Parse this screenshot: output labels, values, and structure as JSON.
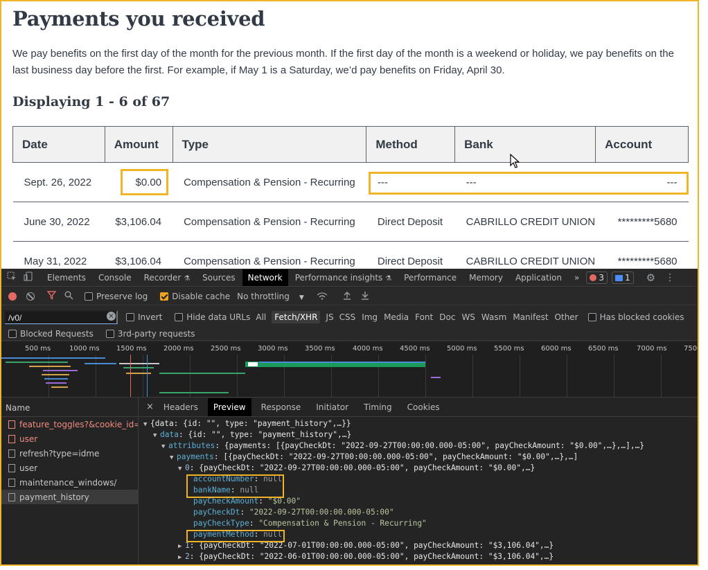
{
  "page": {
    "title": "Payments you received",
    "description": "We pay benefits on the first day of the month for the previous month. If the first day of the month is a weekend or holiday, we pay benefits on the last business day before the first. For example, if May 1 is a Saturday, we’d pay benefits on Friday, April 30.",
    "displaying": "Displaying 1 - 6 of 67",
    "columns": [
      "Date",
      "Amount",
      "Type",
      "Method",
      "Bank",
      "Account"
    ],
    "rows": [
      {
        "date": "Sept. 26, 2022",
        "amount": "$0.00",
        "type": "Compensation & Pension - Recurring",
        "method": "---",
        "bank": "---",
        "account": "---"
      },
      {
        "date": "June 30, 2022",
        "amount": "$3,106.04",
        "type": "Compensation & Pension - Recurring",
        "method": "Direct Deposit",
        "bank": "CABRILLO CREDIT UNION",
        "account": "*********5680"
      },
      {
        "date": "May 31, 2022",
        "amount": "$3,106.04",
        "type": "Compensation & Pension - Recurring",
        "method": "Direct Deposit",
        "bank": "CABRILLO CREDIT UNION",
        "account": "*********5680"
      }
    ]
  },
  "devtools": {
    "tabs": [
      "Elements",
      "Console",
      "Recorder",
      "Sources",
      "Network",
      "Performance insights",
      "Performance",
      "Memory",
      "Application"
    ],
    "active_tab": "Network",
    "more": "»",
    "errors_count": "3",
    "messages_count": "1",
    "toolbar": {
      "preserve_log": "Preserve log",
      "disable_cache": "Disable cache",
      "throttling": "No throttling"
    },
    "filter": {
      "value": "/v0/",
      "invert": "Invert",
      "hide_data_urls": "Hide data URLs",
      "types": [
        "All",
        "Fetch/XHR",
        "JS",
        "CSS",
        "Img",
        "Media",
        "Font",
        "Doc",
        "WS",
        "Wasm",
        "Manifest",
        "Other"
      ],
      "active_type": "Fetch/XHR",
      "has_blocked_cookies": "Has blocked cookies",
      "blocked_requests": "Blocked Requests",
      "third_party": "3rd-party requests"
    },
    "timeline_ticks": [
      "500 ms",
      "1000 ms",
      "1500 ms",
      "2000 ms",
      "2500 ms",
      "3000 ms",
      "3500 ms",
      "4000 ms",
      "4500 ms",
      "5000 ms",
      "5500 ms",
      "6000 ms",
      "6500 ms",
      "7000 ms",
      "7500"
    ],
    "name_header": "Name",
    "requests": [
      {
        "name": "feature_toggles?&cookie_id=j...",
        "error": true
      },
      {
        "name": "user",
        "error": true
      },
      {
        "name": "refresh?type=idme",
        "error": false
      },
      {
        "name": "user",
        "error": false
      },
      {
        "name": "maintenance_windows/",
        "error": false
      },
      {
        "name": "payment_history",
        "error": false
      }
    ],
    "detail_close": "×",
    "detail_tabs": [
      "Headers",
      "Preview",
      "Response",
      "Initiator",
      "Timing",
      "Cookies"
    ],
    "detail_active": "Preview",
    "json": {
      "l1": "{data: {id: \"\", type: \"payment_history\",…}}",
      "l2_key": "data",
      "l2_val": "{id: \"\", type: \"payment_history\",…}",
      "l3_key": "attributes",
      "l3_val": "{payments: [{payCheckDt: \"2022-09-27T00:00:00.000-05:00\", payCheckAmount: \"$0.00\",…},…],…}",
      "l4_key": "payments",
      "l4_val": "[{payCheckDt: \"2022-09-27T00:00:00.000-05:00\", payCheckAmount: \"$0.00\",…},…]",
      "l5_key": "0",
      "l5_val": "{payCheckDt: \"2022-09-27T00:00:00.000-05:00\", payCheckAmount: \"$0.00\",…}",
      "account_key": "accountNumber",
      "bank_key": "bankName",
      "null": "null",
      "amount_key": "payCheckAmount",
      "amount_val": "\"$0.00\"",
      "dt_key": "payCheckDt",
      "dt_val": "\"2022-09-27T00:00:00.000-05:00\"",
      "type_key": "payCheckType",
      "type_val": "\"Compensation & Pension - Recurring\"",
      "method_key": "paymentMethod",
      "l6_key": "1",
      "l6_val": "{payCheckDt: \"2022-07-01T00:00:00.000-05:00\", payCheckAmount: \"$3,106.04\",…}",
      "l7_key": "2",
      "l7_val": "{payCheckDt: \"2022-06-01T00:00:00.000-05:00\", payCheckAmount: \"$3,106.04\",…}"
    }
  },
  "colors": {
    "highlight": "#f0b429",
    "devtools_bg": "#242424",
    "key_blue": "#5db0d7",
    "string_orange": "#f28b54"
  }
}
